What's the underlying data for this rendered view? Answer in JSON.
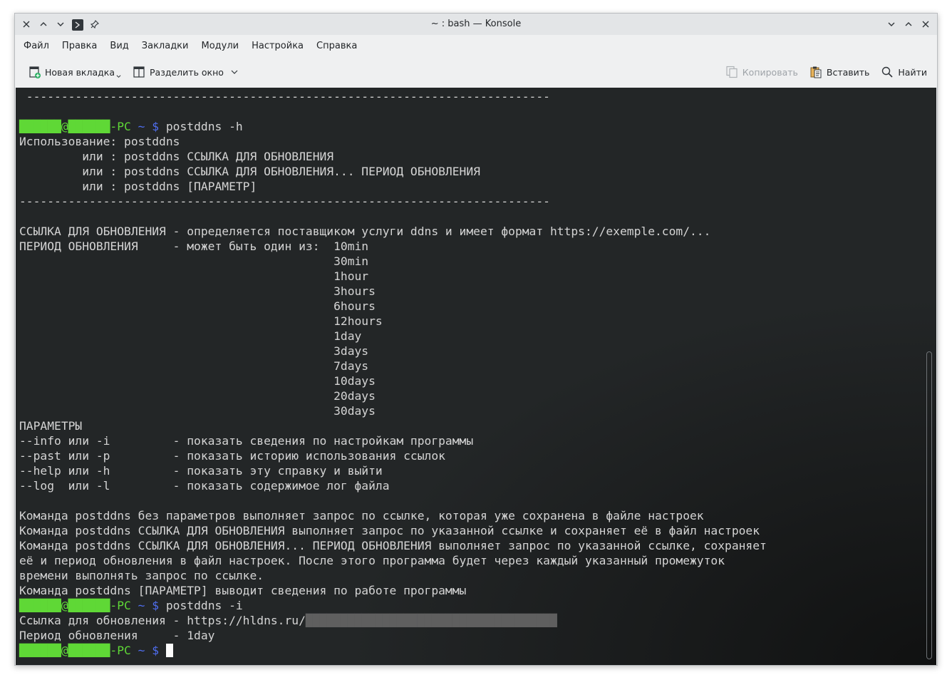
{
  "window": {
    "title": "~ : bash — Konsole"
  },
  "menubar": {
    "items": [
      "Файл",
      "Правка",
      "Вид",
      "Закладки",
      "Модули",
      "Настройка",
      "Справка"
    ]
  },
  "toolbar": {
    "new_tab": "Новая вкладка",
    "split_view": "Разделить окно",
    "copy": "Копировать",
    "paste": "Вставить",
    "find": "Найти"
  },
  "terminal": {
    "prompt_user": "██████@██████-PC",
    "prompt_tilde": "~",
    "prompt_dollar": "$",
    "lines": [
      {
        "type": "text",
        "text": " ---------------------------------------------------------------------------"
      },
      {
        "type": "text",
        "text": ""
      },
      {
        "type": "prompt",
        "cmd": " postddns -h"
      },
      {
        "type": "text",
        "text": "Использование: postddns"
      },
      {
        "type": "text",
        "text": "         или : postddns ССЫЛКА ДЛЯ ОБНОВЛЕНИЯ"
      },
      {
        "type": "text",
        "text": "         или : postddns ССЫЛКА ДЛЯ ОБНОВЛЕНИЯ... ПЕРИОД ОБНОВЛЕНИЯ"
      },
      {
        "type": "text",
        "text": "         или : postddns [ПАРАМЕТР]"
      },
      {
        "type": "text",
        "text": "----------------------------------------------------------------------------"
      },
      {
        "type": "text",
        "text": ""
      },
      {
        "type": "text",
        "text": "ССЫЛКА ДЛЯ ОБНОВЛЕНИЯ - определяется поставщиком услуги ddns и имеет формат https://exemple.com/..."
      },
      {
        "type": "text",
        "text": "ПЕРИОД ОБНОВЛЕНИЯ     - может быть один из:  10min"
      },
      {
        "type": "text",
        "text": "                                             30min"
      },
      {
        "type": "text",
        "text": "                                             1hour"
      },
      {
        "type": "text",
        "text": "                                             3hours"
      },
      {
        "type": "text",
        "text": "                                             6hours"
      },
      {
        "type": "text",
        "text": "                                             12hours"
      },
      {
        "type": "text",
        "text": "                                             1day"
      },
      {
        "type": "text",
        "text": "                                             3days"
      },
      {
        "type": "text",
        "text": "                                             7days"
      },
      {
        "type": "text",
        "text": "                                             10days"
      },
      {
        "type": "text",
        "text": "                                             20days"
      },
      {
        "type": "text",
        "text": "                                             30days"
      },
      {
        "type": "text",
        "text": "ПАРАМЕТРЫ"
      },
      {
        "type": "text",
        "text": "--info или -i         - показать сведения по настройкам программы"
      },
      {
        "type": "text",
        "text": "--past или -p         - показать историю использования ссылок"
      },
      {
        "type": "text",
        "text": "--help или -h         - показать эту справку и выйти"
      },
      {
        "type": "text",
        "text": "--log  или -l         - показать содержимое лог файла"
      },
      {
        "type": "text",
        "text": ""
      },
      {
        "type": "text",
        "text": "Команда postddns без параметров выполняет запрос по ссылке, которая уже сохранена в файле настроек"
      },
      {
        "type": "text",
        "text": "Команда postddns ССЫЛКА ДЛЯ ОБНОВЛЕНИЯ выполняет запрос по указанной ссылке и сохраняет её в файл настроек"
      },
      {
        "type": "text",
        "text": "Команда postddns ССЫЛКА ДЛЯ ОБНОВЛЕНИЯ... ПЕРИОД ОБНОВЛЕНИЯ выполняет запрос по указанной ссылке, сохраняет"
      },
      {
        "type": "text",
        "text": "её и период обновления в файл настроек. После этого программа будет через каждый указанный промежуток"
      },
      {
        "type": "text",
        "text": "времени выполнять запрос по ссылке."
      },
      {
        "type": "text",
        "text": "Команда postddns [ПАРАМЕТР] выводит сведения по работе программы"
      },
      {
        "type": "prompt",
        "cmd": " postddns -i"
      },
      {
        "type": "url",
        "text": "Ссылка для обновления - https://hldns.ru/",
        "blurred": "████████████████████████████████████"
      },
      {
        "type": "text",
        "text": "Период обновления     - 1day"
      },
      {
        "type": "prompt_cursor",
        "cmd": " "
      }
    ]
  }
}
